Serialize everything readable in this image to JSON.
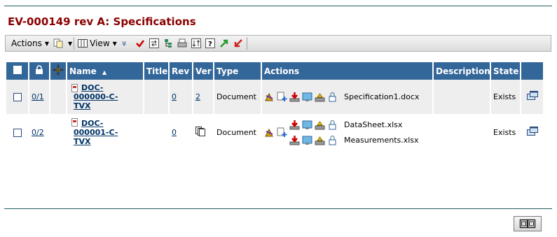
{
  "page": {
    "title": "EV-000149 rev A: Specifications"
  },
  "toolbar": {
    "actions_label": "Actions",
    "view_label": "View",
    "icons": [
      "copy-icon",
      "columns-icon",
      "filter-icon",
      "check-icon",
      "compare-icon",
      "tree-icon",
      "print-icon",
      "sort-icon",
      "help-icon",
      "promote-icon",
      "demote-icon"
    ]
  },
  "table": {
    "columns": [
      "Name",
      "Title",
      "Rev",
      "Ver",
      "Type",
      "Actions",
      "Description",
      "State"
    ],
    "sort_indicator": "▲",
    "rows": [
      {
        "level": "0/1",
        "name_line1": "DOC-",
        "name_line2": "000000-C-",
        "name_line3": "TVX",
        "title": "",
        "rev": "0",
        "ver": "2",
        "type": "Document",
        "files": [
          "Specification1.docx"
        ],
        "description": "",
        "state": "Exists"
      },
      {
        "level": "0/2",
        "name_line1": "DOC-",
        "name_line2": "000001-C-",
        "name_line3": "TVX",
        "title": "",
        "rev": "0",
        "ver": "",
        "type": "Document",
        "files": [
          "DataSheet.xlsx",
          "Measurements.xlsx"
        ],
        "description": "",
        "state": "Exists"
      }
    ]
  },
  "colors": {
    "title": "#8b0000",
    "header_bg": "#336699",
    "link": "#003366"
  }
}
